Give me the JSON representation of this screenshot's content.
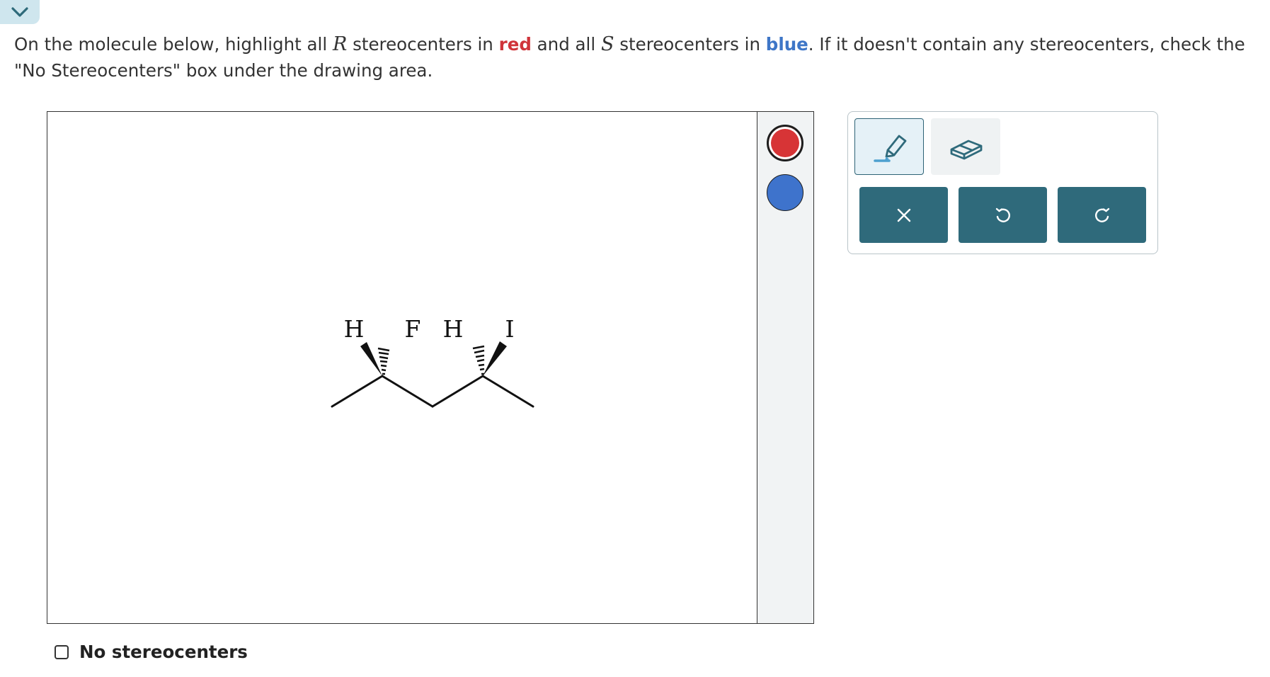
{
  "instructions": {
    "part1": "On the molecule below, highlight all ",
    "r_symbol": "R",
    "part2": " stereocenters in ",
    "red_word": "red",
    "part3": " and all ",
    "s_symbol": "S",
    "part4": " stereocenters in ",
    "blue_word": "blue",
    "part5": ". If it doesn't contain any stereocenters, check the \"No Stereocenters\" box under the drawing area."
  },
  "molecule": {
    "atoms": {
      "h1": "H",
      "f": "F",
      "h2": "H",
      "i": "I"
    }
  },
  "colors": {
    "red": "#d73436",
    "blue": "#3e73cc",
    "accent": "#2f6a7b"
  },
  "icons": {
    "collapse": "chevron-down-icon",
    "highlighter": "highlighter-icon",
    "eraser": "eraser-icon",
    "clear": "close-icon",
    "undo": "undo-icon",
    "redo": "redo-icon"
  },
  "no_stereocenters": {
    "label": "No stereocenters",
    "checked": false
  }
}
